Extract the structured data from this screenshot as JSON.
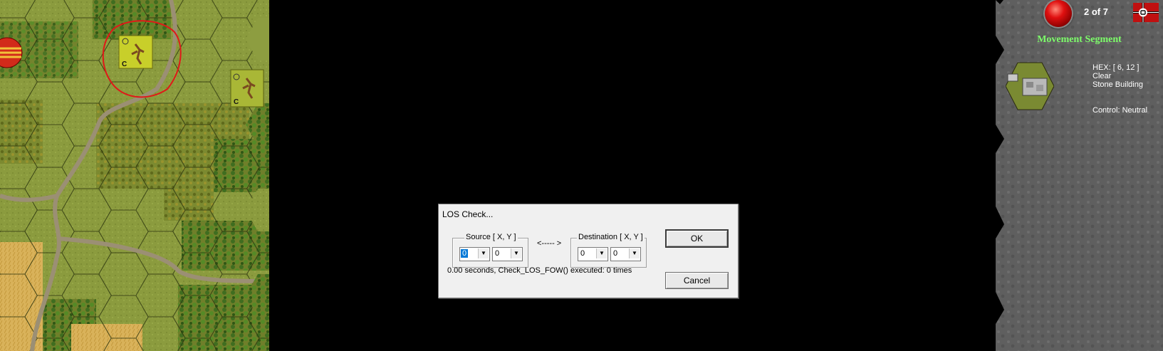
{
  "panel": {
    "turn_text": "2 of 7",
    "phase_text": "Movement Segment",
    "hex_coord": "HEX: [ 6, 12 ]",
    "hex_terrain": "Clear",
    "hex_building": "Stone Building",
    "hex_control": "Control: Neutral"
  },
  "map": {
    "unit_markers": [
      {
        "label": "C"
      },
      {
        "label": "C"
      }
    ],
    "colors": {
      "grass": "#8a9a3c",
      "hex_line": "#2a2a10",
      "road": "#9b8f74",
      "selection": "#e01818"
    }
  },
  "dialog": {
    "title": "LOS Check...",
    "source_label": "Source [ X, Y ]",
    "source_x": "0",
    "source_y": "0",
    "arrow": "<----- >",
    "destination_label": "Destination [ X, Y ]",
    "dest_x": "0",
    "dest_y": "0",
    "ok_label": "OK",
    "cancel_label": "Cancel",
    "status": "0.00 seconds, Check_LOS_FOW() executed: 0 times",
    "dropdown_icon": "triangle-down"
  }
}
